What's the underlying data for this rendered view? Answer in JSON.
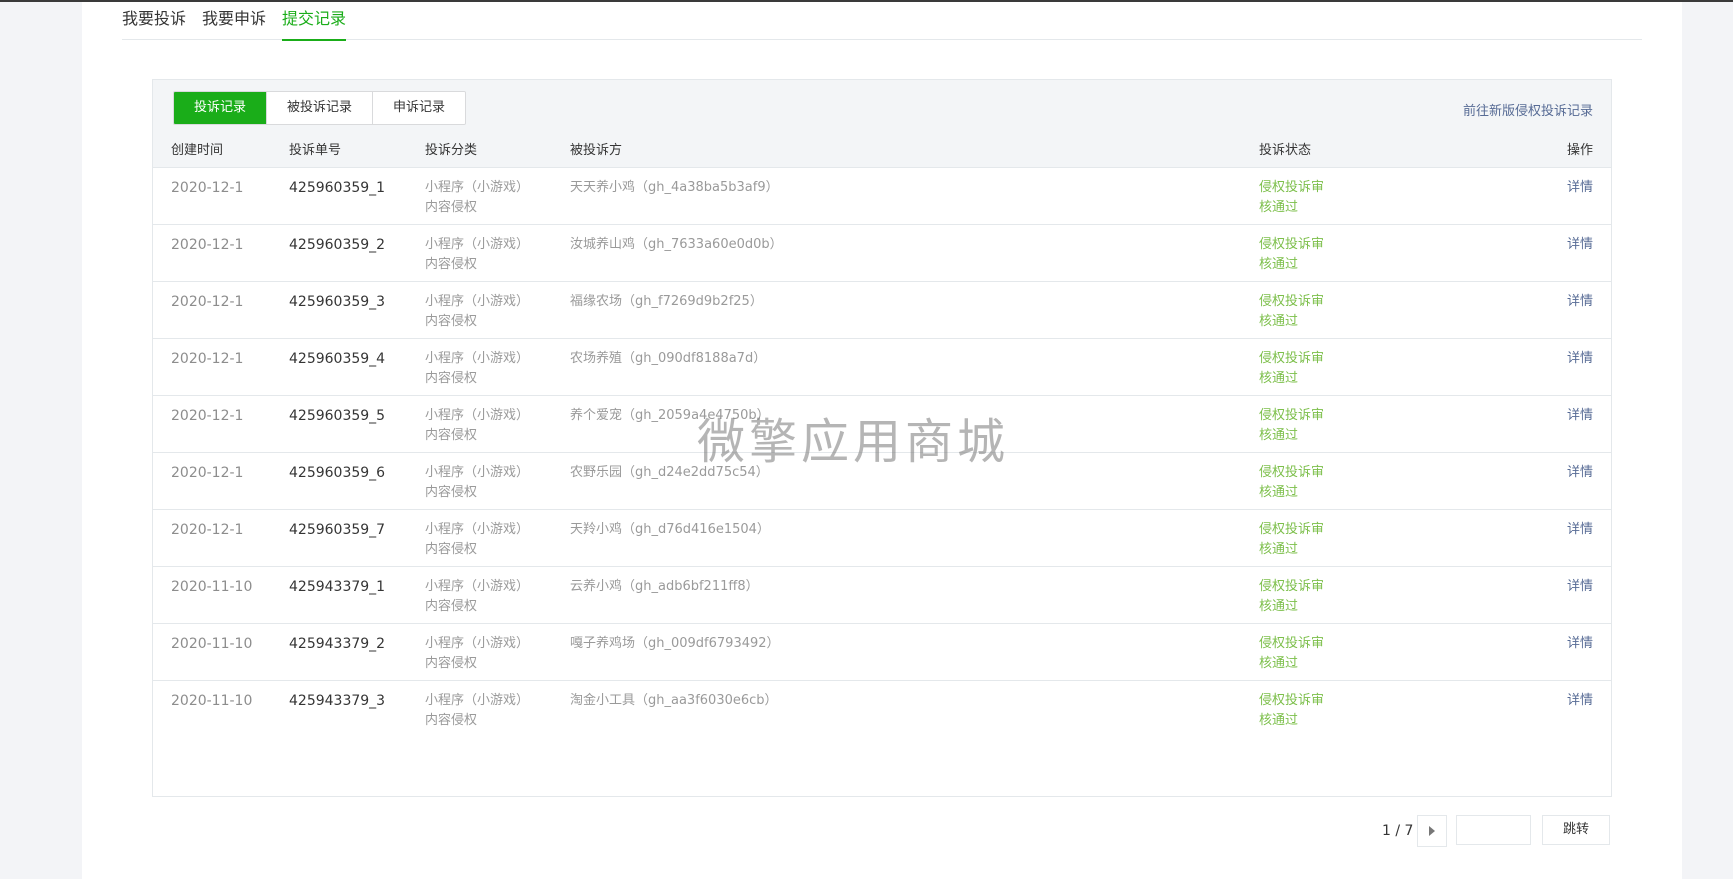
{
  "top_tabs": [
    {
      "label": "我要投诉",
      "active": false
    },
    {
      "label": "我要申诉",
      "active": false
    },
    {
      "label": "提交记录",
      "active": true
    }
  ],
  "segments": [
    {
      "label": "投诉记录",
      "active": true
    },
    {
      "label": "被投诉记录",
      "active": false
    },
    {
      "label": "申诉记录",
      "active": false
    }
  ],
  "new_link": "前往新版侵权投诉记录",
  "columns": {
    "time": "创建时间",
    "no": "投诉单号",
    "category": "投诉分类",
    "target": "被投诉方",
    "status": "投诉状态",
    "op": "操作"
  },
  "rows": [
    {
      "time": "2020-12-1",
      "no": "425960359_1",
      "cat1": "小程序（小游戏）",
      "cat2": "内容侵权",
      "target": "天天养小鸡（gh_4a38ba5b3af9）",
      "status1": "侵权投诉审",
      "status2": "核通过",
      "op": "详情"
    },
    {
      "time": "2020-12-1",
      "no": "425960359_2",
      "cat1": "小程序（小游戏）",
      "cat2": "内容侵权",
      "target": "汝城养山鸡（gh_7633a60e0d0b）",
      "status1": "侵权投诉审",
      "status2": "核通过",
      "op": "详情"
    },
    {
      "time": "2020-12-1",
      "no": "425960359_3",
      "cat1": "小程序（小游戏）",
      "cat2": "内容侵权",
      "target": "福缘农场（gh_f7269d9b2f25）",
      "status1": "侵权投诉审",
      "status2": "核通过",
      "op": "详情"
    },
    {
      "time": "2020-12-1",
      "no": "425960359_4",
      "cat1": "小程序（小游戏）",
      "cat2": "内容侵权",
      "target": "农场养殖（gh_090df8188a7d）",
      "status1": "侵权投诉审",
      "status2": "核通过",
      "op": "详情"
    },
    {
      "time": "2020-12-1",
      "no": "425960359_5",
      "cat1": "小程序（小游戏）",
      "cat2": "内容侵权",
      "target": "养个爱宠（gh_2059a4e4750b）",
      "status1": "侵权投诉审",
      "status2": "核通过",
      "op": "详情"
    },
    {
      "time": "2020-12-1",
      "no": "425960359_6",
      "cat1": "小程序（小游戏）",
      "cat2": "内容侵权",
      "target": "农野乐园（gh_d24e2dd75c54）",
      "status1": "侵权投诉审",
      "status2": "核通过",
      "op": "详情"
    },
    {
      "time": "2020-12-1",
      "no": "425960359_7",
      "cat1": "小程序（小游戏）",
      "cat2": "内容侵权",
      "target": "天羚小鸡（gh_d76d416e1504）",
      "status1": "侵权投诉审",
      "status2": "核通过",
      "op": "详情"
    },
    {
      "time": "2020-11-10",
      "no": "425943379_1",
      "cat1": "小程序（小游戏）",
      "cat2": "内容侵权",
      "target": "云养小鸡（gh_adb6bf211ff8）",
      "status1": "侵权投诉审",
      "status2": "核通过",
      "op": "详情"
    },
    {
      "time": "2020-11-10",
      "no": "425943379_2",
      "cat1": "小程序（小游戏）",
      "cat2": "内容侵权",
      "target": "嘎子养鸡场（gh_009df6793492）",
      "status1": "侵权投诉审",
      "status2": "核通过",
      "op": "详情"
    },
    {
      "time": "2020-11-10",
      "no": "425943379_3",
      "cat1": "小程序（小游戏）",
      "cat2": "内容侵权",
      "target": "淘金小工具（gh_aa3f6030e6cb）",
      "status1": "侵权投诉审",
      "status2": "核通过",
      "op": "详情"
    }
  ],
  "pager": {
    "page_text": "1 / 7",
    "jump_label": "跳转",
    "input_value": ""
  },
  "watermark": "微擎应用商城",
  "colors": {
    "accent": "#1aad19",
    "link": "#576b95",
    "status": "#7cbf4a"
  }
}
